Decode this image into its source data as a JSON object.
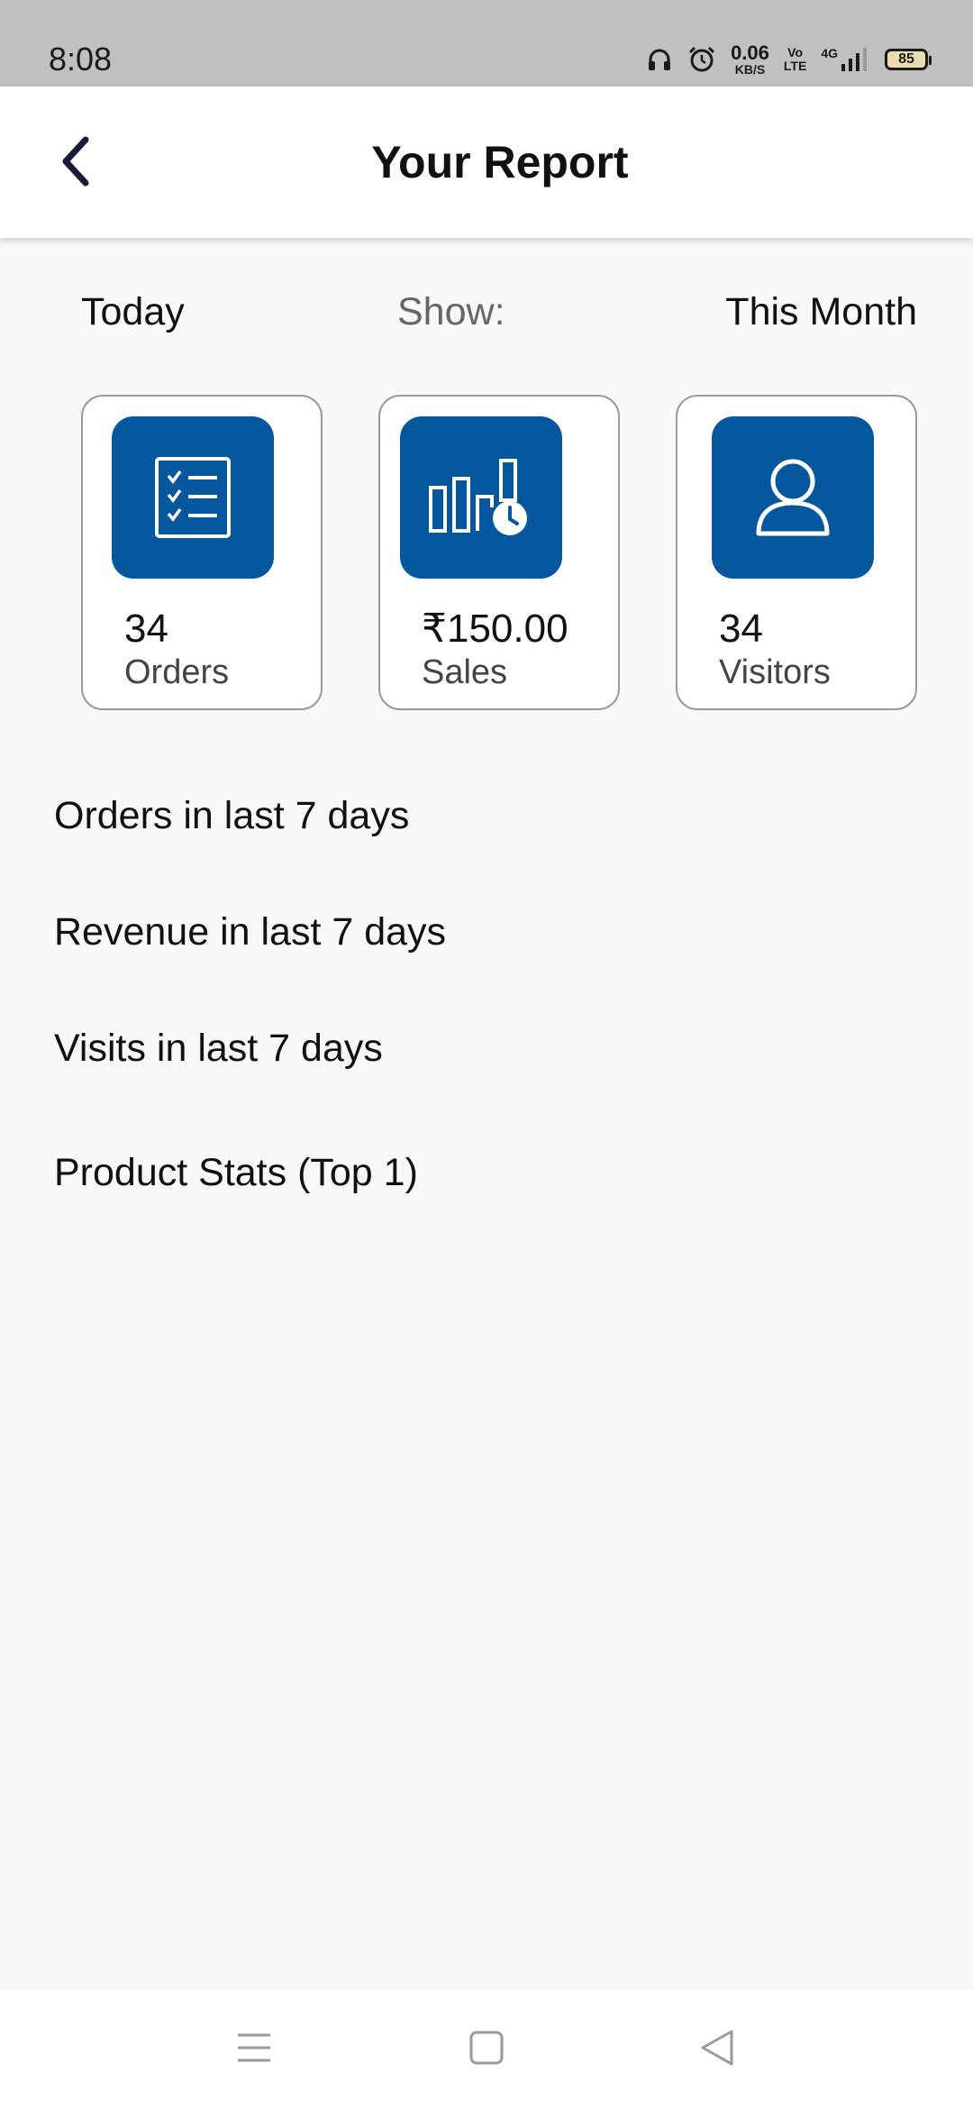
{
  "status_bar": {
    "time": "8:08",
    "net_speed_value": "0.06",
    "net_speed_unit": "KB/S",
    "volte_top": "Vo",
    "volte_bottom": "LTE",
    "network_type": "4G",
    "battery_level": "85",
    "icons": [
      "headset-icon",
      "alarm-icon",
      "signal-icon",
      "battery-icon"
    ]
  },
  "app_bar": {
    "title": "Your Report",
    "back_icon": "chevron-left-icon"
  },
  "filter": {
    "today_label": "Today",
    "show_label": "Show:",
    "month_label": "This Month"
  },
  "cards": [
    {
      "value": "34",
      "label": "Orders",
      "icon": "checklist-icon"
    },
    {
      "value": "₹150.00",
      "label": "Sales",
      "icon": "bar-chart-clock-icon"
    },
    {
      "value": "34",
      "label": "Visitors",
      "icon": "user-icon"
    }
  ],
  "sections": {
    "orders": "Orders in last 7 days",
    "revenue": "Revenue in last 7 days",
    "visits": "Visits in last 7 days",
    "products": "Product Stats (Top 1)"
  },
  "colors": {
    "accent": "#05589d",
    "status_bar_bg": "#c0c0c0",
    "page_bg": "#f8f8f8"
  },
  "nav_bar": {
    "icons": [
      "menu-icon",
      "home-square-icon",
      "back-triangle-icon"
    ]
  }
}
